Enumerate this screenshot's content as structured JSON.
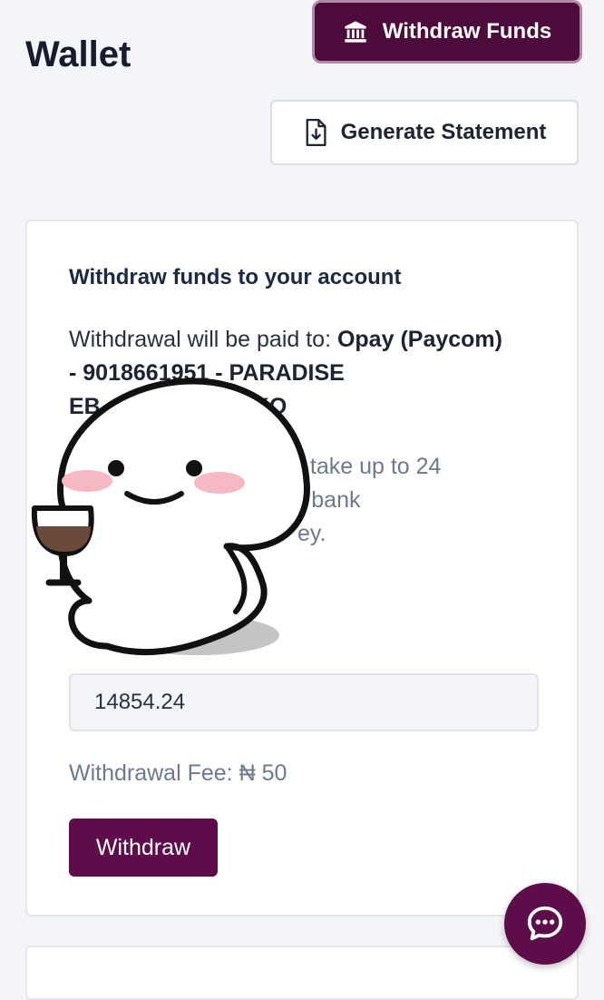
{
  "page": {
    "title": "Wallet"
  },
  "header": {
    "withdraw_funds_label": "Withdraw Funds",
    "withdraw_funds_icon": "bank-icon",
    "generate_statement_label": "Generate Statement",
    "generate_statement_icon": "file-download-icon"
  },
  "card": {
    "title": "Withdraw funds to your account",
    "paid_to_prefix": "Withdrawal will be paid to: ",
    "paid_to_account": "Opay (Paycom) - 9018661951 - PARADISE EB",
    "paid_to_account_end": "UKO",
    "notice_line1": "t take up to 24",
    "notice_line2": "r bank",
    "notice_line3": "ey.",
    "amount_value": "14854.24",
    "fee_label": "Withdrawal Fee: ",
    "fee_value": "₦ 50",
    "withdraw_button": "Withdraw"
  },
  "chat": {
    "icon": "chat-icon"
  },
  "colors": {
    "brand": "#5c0d4a",
    "background": "#f3f5f9",
    "muted_text": "#6d7a8d"
  }
}
